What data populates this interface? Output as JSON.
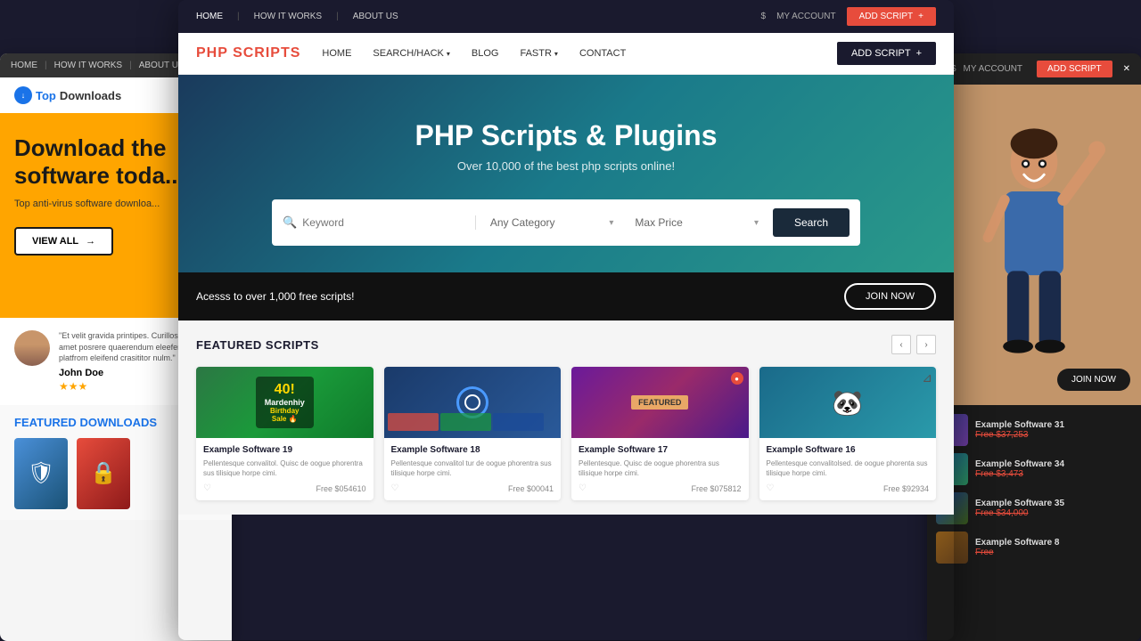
{
  "leftPanel": {
    "nav": {
      "home": "HOME",
      "howItWorks": "HOW IT WORKS",
      "about": "ABOUT US"
    },
    "logo": {
      "prefix": "Top",
      "suffix": "Downloads"
    },
    "hero": {
      "line1": "Download the",
      "line2": "software toda...",
      "subtitle": "Top anti-virus software downloa...",
      "viewAllBtn": "VIEW ALL"
    },
    "testimonial": {
      "quote": "\"Et velit gravida printipes. Curillos nulla sit amet posrere quaerendum eleefend platfrom eleifend crasititor nulm.\"",
      "name": "John Doe",
      "stars": "★★★"
    },
    "featuredSection": {
      "title": "FEATURED",
      "titleHighlight": "DOWNLOADS"
    }
  },
  "rightPanel": {
    "addScriptBtn": "ADD SCRIPT",
    "joinNow": "JOIN NOW",
    "items": [
      {
        "title": "Example Software 31",
        "price": "Free $37,253",
        "originalPrice": "$37,253"
      },
      {
        "title": "Example Software 34",
        "price": "Free $3,473",
        "originalPrice": "$3,473"
      },
      {
        "title": "Example Software 35",
        "price": "Free $34,000",
        "originalPrice": "$34,000"
      },
      {
        "title": "Example Software 8",
        "price": "Free",
        "originalPrice": ""
      }
    ]
  },
  "centerPanel": {
    "topNav": {
      "home": "HOME",
      "howItWorks": "HOW IT WORKS",
      "about": "ABOUT US",
      "separator": "|",
      "dollar": "$",
      "myAccount": "MY ACCOUNT",
      "addScriptBtn": "ADD SCRIPT",
      "addScriptIcon": "+"
    },
    "subNav": {
      "brand": "PHP SCRIPTS",
      "brandHighlight": "PHP",
      "links": [
        "HOME",
        "SEARCH/HACK",
        "BLOG",
        "FASTR",
        "CONTACT"
      ],
      "addScriptBtn": "ADD SCRIPT",
      "addIcon": "+"
    },
    "hero": {
      "title": "PHP Scripts & Plugins",
      "subtitle": "Over 10,000 of the best php scripts online!",
      "searchPlaceholder": "Keyword",
      "categoryDefault": "Any Category",
      "priceDefault": "Max Price",
      "searchBtn": "Search"
    },
    "accessBar": {
      "text": "Acesss to over 1,000 free scripts!",
      "joinNow": "JOIN NOW"
    },
    "featuredScripts": {
      "title": "FEATURED SCRIPTS",
      "cards": [
        {
          "title": "Example Software 19",
          "description": "Pellentesque convalitol. Quisc de oogue phorentra sus tilisique horpe cimi.",
          "price": "Free $054610",
          "badge": ""
        },
        {
          "title": "Example Software 18",
          "description": "Pellentesque convalitol tur de oogue phorentra sus tilisique horpe cimi.",
          "price": "Free $00041",
          "badge": ""
        },
        {
          "title": "Example Software 17",
          "description": "Pellentesque. Quisc de oogue phorentra sus tilisique horpe cimi.",
          "price": "Free $075812",
          "badge": "●"
        },
        {
          "title": "Example Software 16",
          "description": "Pellentesque convalitolsed. de oogue phorenta sus tilisique horpe cimi.",
          "price": "Free $92934",
          "badge": ""
        }
      ]
    }
  }
}
